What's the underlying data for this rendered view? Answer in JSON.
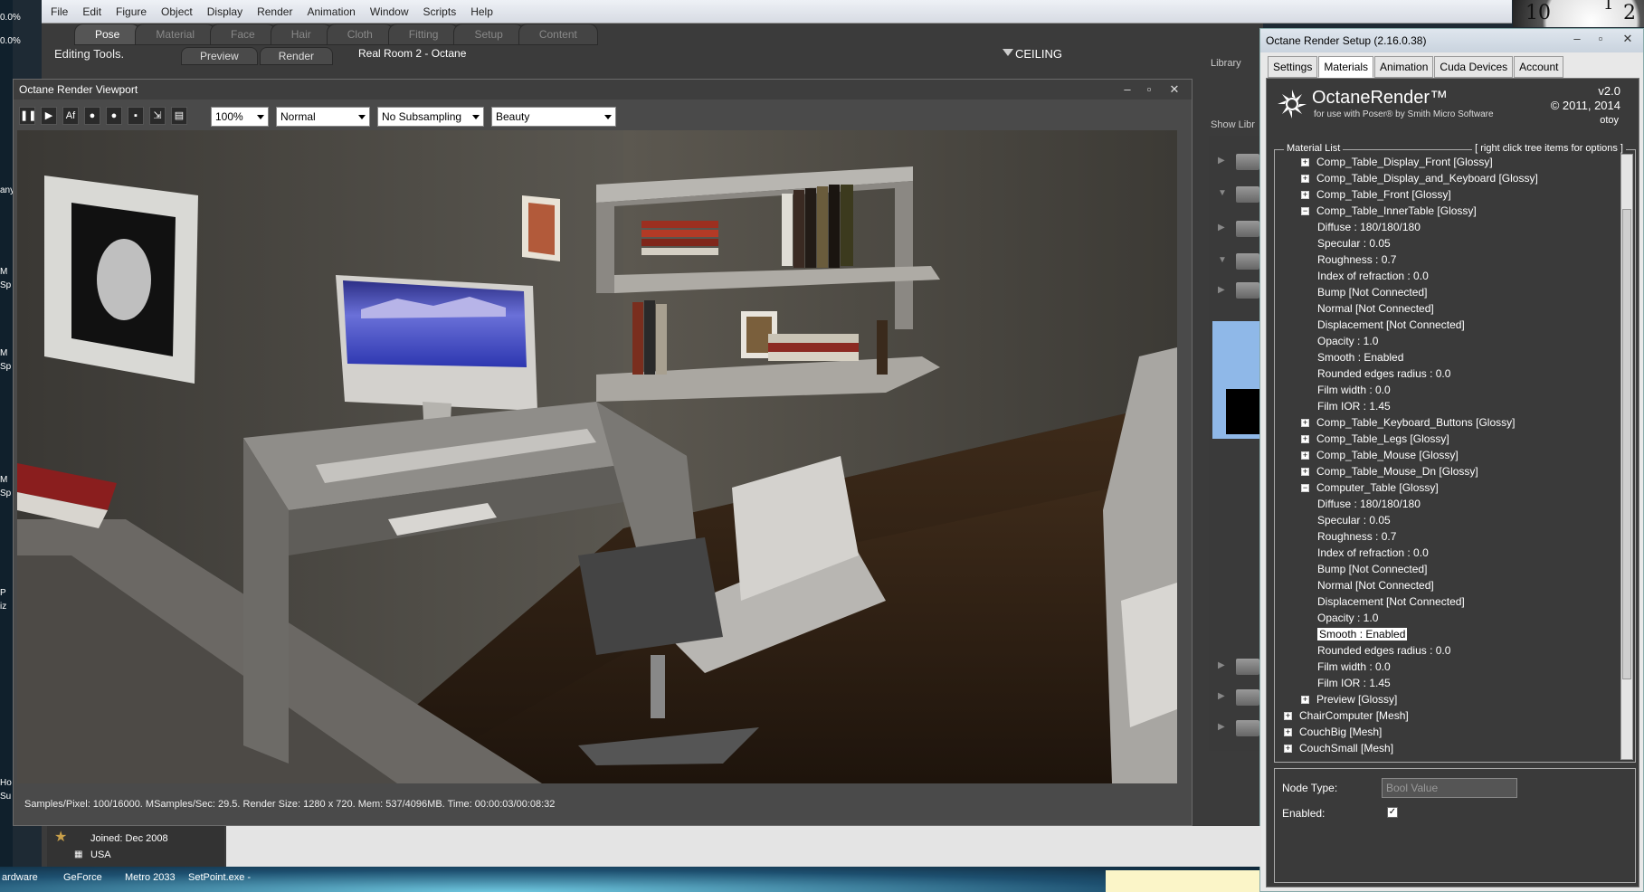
{
  "desktop": {
    "left_texts": [
      "0.0%",
      "0.0%",
      "any",
      "M",
      "Sp",
      "M",
      "Sp",
      "M",
      "Sp",
      "P",
      "iz",
      "Ho",
      "Su"
    ],
    "bottom_labels": [
      "ardware",
      "GeForce",
      "Metro 2033",
      "SetPoint.exe -"
    ]
  },
  "clock": {
    "numbers": [
      "10",
      "1",
      "2"
    ]
  },
  "poser": {
    "menu": [
      "File",
      "Edit",
      "Figure",
      "Object",
      "Display",
      "Render",
      "Animation",
      "Window",
      "Scripts",
      "Help"
    ],
    "room_tabs": [
      "Pose",
      "Material",
      "Face",
      "Hair",
      "Cloth",
      "Fitting",
      "Setup",
      "Content"
    ],
    "active_room_tab": "Pose",
    "editing_tools": "Editing Tools.",
    "sub_tabs": [
      "Preview",
      "Render"
    ],
    "document_title": "Real Room 2 - Octane",
    "ceiling_label": "CEILING",
    "library_label": "Library",
    "show_library": "Show Libr"
  },
  "viewport": {
    "title": "Octane Render Viewport",
    "zoom": "100%",
    "mode": "Normal",
    "subsampling": "No Subsampling",
    "pass": "Beauty",
    "status": "Samples/Pixel: 100/16000. MSamples/Sec: 29.5. Render Size: 1280 x 720. Mem: 537/4096MB. Time: 00:00:03/00:08:32"
  },
  "setup": {
    "title": "Octane Render Setup (2.16.0.38)",
    "tabs": [
      "Settings",
      "Materials",
      "Animation",
      "Cuda Devices",
      "Account"
    ],
    "active_tab": "Materials",
    "product_name": "OctaneRender™",
    "product_sub": "for use with Poser® by Smith Micro Software",
    "version": "v2.0",
    "copyright": "© 2011, 2014",
    "brand": "otoy",
    "material_list_label": "Material List",
    "material_list_hint": "[ right click tree items for options ]",
    "tree": [
      {
        "indent": 1,
        "expander": "+",
        "text": "Comp_Table_Display_Front  [Glossy]"
      },
      {
        "indent": 1,
        "expander": "+",
        "text": "Comp_Table_Display_and_Keyboard  [Glossy]"
      },
      {
        "indent": 1,
        "expander": "+",
        "text": "Comp_Table_Front  [Glossy]"
      },
      {
        "indent": 1,
        "expander": "-",
        "text": "Comp_Table_InnerTable  [Glossy]"
      },
      {
        "indent": 2,
        "expander": "",
        "text": "Diffuse  :  180/180/180"
      },
      {
        "indent": 2,
        "expander": "",
        "text": "Specular  :  0.05"
      },
      {
        "indent": 2,
        "expander": "",
        "text": "Roughness  :  0.7"
      },
      {
        "indent": 2,
        "expander": "",
        "text": "Index of refraction  :  0.0"
      },
      {
        "indent": 2,
        "expander": "",
        "text": "Bump  [Not Connected]"
      },
      {
        "indent": 2,
        "expander": "",
        "text": "Normal  [Not Connected]"
      },
      {
        "indent": 2,
        "expander": "",
        "text": "Displacement  [Not Connected]"
      },
      {
        "indent": 2,
        "expander": "",
        "text": "Opacity  :  1.0"
      },
      {
        "indent": 2,
        "expander": "",
        "text": "Smooth  :  Enabled"
      },
      {
        "indent": 2,
        "expander": "",
        "text": "Rounded edges radius  :  0.0"
      },
      {
        "indent": 2,
        "expander": "",
        "text": "Film width  :  0.0"
      },
      {
        "indent": 2,
        "expander": "",
        "text": "Film IOR  :  1.45"
      },
      {
        "indent": 1,
        "expander": "+",
        "text": "Comp_Table_Keyboard_Buttons  [Glossy]"
      },
      {
        "indent": 1,
        "expander": "+",
        "text": "Comp_Table_Legs  [Glossy]"
      },
      {
        "indent": 1,
        "expander": "+",
        "text": "Comp_Table_Mouse  [Glossy]"
      },
      {
        "indent": 1,
        "expander": "+",
        "text": "Comp_Table_Mouse_Dn  [Glossy]"
      },
      {
        "indent": 1,
        "expander": "-",
        "text": "Computer_Table  [Glossy]"
      },
      {
        "indent": 2,
        "expander": "",
        "text": "Diffuse  :  180/180/180"
      },
      {
        "indent": 2,
        "expander": "",
        "text": "Specular  :  0.05"
      },
      {
        "indent": 2,
        "expander": "",
        "text": "Roughness  :  0.7"
      },
      {
        "indent": 2,
        "expander": "",
        "text": "Index of refraction  :  0.0"
      },
      {
        "indent": 2,
        "expander": "",
        "text": "Bump  [Not Connected]"
      },
      {
        "indent": 2,
        "expander": "",
        "text": "Normal  [Not Connected]"
      },
      {
        "indent": 2,
        "expander": "",
        "text": "Displacement  [Not Connected]"
      },
      {
        "indent": 2,
        "expander": "",
        "text": "Opacity  :  1.0"
      },
      {
        "indent": 2,
        "expander": "",
        "text": "Smooth  :  Enabled",
        "selected": true
      },
      {
        "indent": 2,
        "expander": "",
        "text": "Rounded edges radius  :  0.0"
      },
      {
        "indent": 2,
        "expander": "",
        "text": "Film width  :  0.0"
      },
      {
        "indent": 2,
        "expander": "",
        "text": "Film IOR  :  1.45"
      },
      {
        "indent": 1,
        "expander": "+",
        "text": "Preview  [Glossy]"
      },
      {
        "indent": 0,
        "expander": "+",
        "text": "ChairComputer  [Mesh]"
      },
      {
        "indent": 0,
        "expander": "+",
        "text": "CouchBig  [Mesh]"
      },
      {
        "indent": 0,
        "expander": "+",
        "text": "CouchSmall  [Mesh]"
      }
    ],
    "node_type_label": "Node Type:",
    "node_type_value": "Bool Value",
    "enabled_label": "Enabled:",
    "enabled": true
  },
  "profile": {
    "joined": "Joined: Dec 2008",
    "country": "USA"
  },
  "colors": {
    "menubar": "#e6e9ef",
    "app_bg": "#3b3b3b",
    "panel_bg": "#3a3a3a",
    "selection": "#ffffff"
  }
}
